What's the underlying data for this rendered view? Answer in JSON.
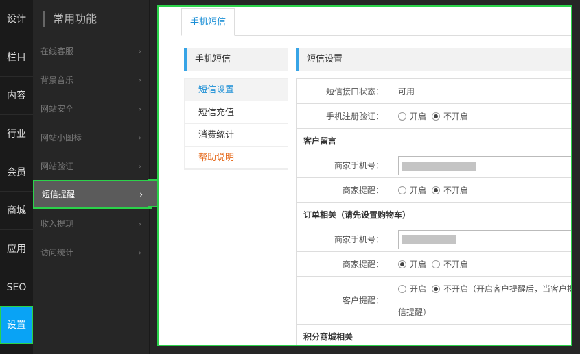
{
  "nav": {
    "items": [
      {
        "label": "设计"
      },
      {
        "label": "栏目"
      },
      {
        "label": "内容"
      },
      {
        "label": "行业"
      },
      {
        "label": "会员"
      },
      {
        "label": "商城"
      },
      {
        "label": "应用"
      },
      {
        "label": "SEO"
      },
      {
        "label": "设置",
        "active": true
      }
    ]
  },
  "submenu": {
    "title": "常用功能",
    "items": [
      {
        "label": "在线客服"
      },
      {
        "label": "背景音乐"
      },
      {
        "label": "网站安全"
      },
      {
        "label": "网站小图标"
      },
      {
        "label": "网站验证"
      },
      {
        "label": "短信提醒",
        "active": true
      },
      {
        "label": "收入提现"
      },
      {
        "label": "访问统计"
      }
    ],
    "chevron": "›"
  },
  "tab": {
    "label": "手机短信"
  },
  "sidecard": {
    "title": "手机短信",
    "items": [
      {
        "label": "短信设置"
      },
      {
        "label": "短信充值"
      },
      {
        "label": "消费统计"
      },
      {
        "label": "帮助说明"
      }
    ]
  },
  "settings": {
    "title": "短信设置",
    "status_label": "短信接口状态：",
    "status_value": "可用",
    "register_label": "手机注册验证：",
    "opt_on": "开启",
    "opt_off": "不开启",
    "group_message": "客户留言",
    "merchant_phone_label": "商家手机号：",
    "merchant_remind_label": "商家提醒：",
    "group_order": "订单相关（请先设置购物车）",
    "order_phone_label": "商家手机号：",
    "order_remind_label": "商家提醒：",
    "customer_remind_label": "客户提醒：",
    "customer_note": "（开启客户提醒后，当客户提",
    "customer_note_2": "信提醒）",
    "group_points": "积分商城相关"
  }
}
